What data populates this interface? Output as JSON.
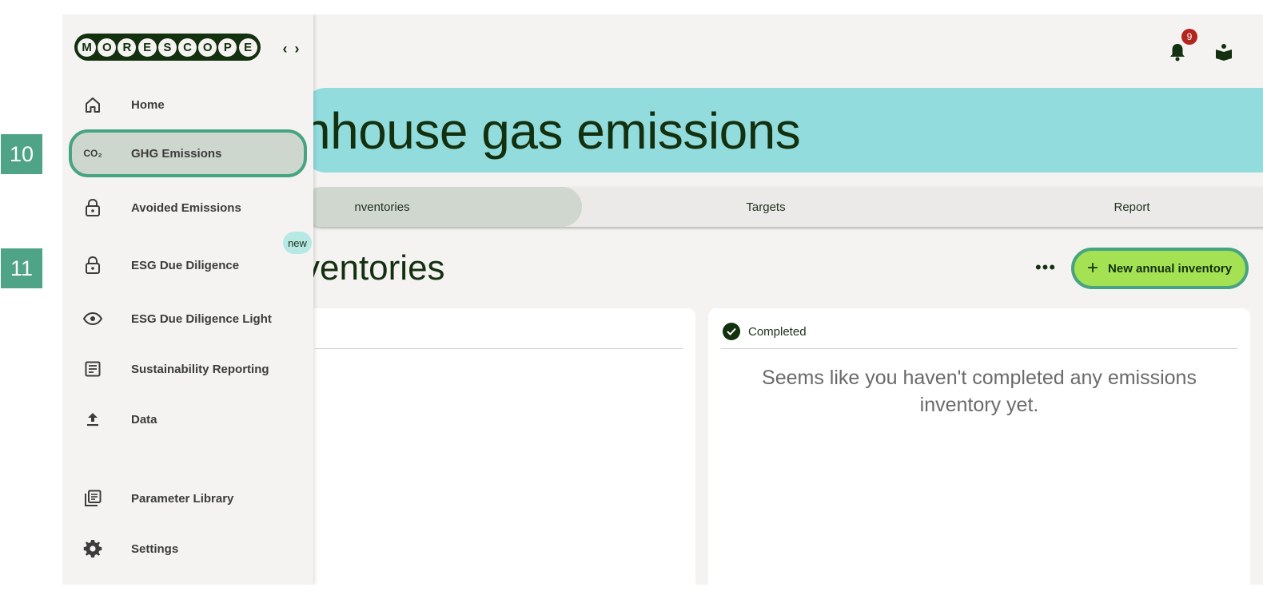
{
  "sidebar": {
    "logo_letters": [
      "M",
      "O",
      "R",
      "E",
      "S",
      "C",
      "O",
      "P",
      "E"
    ],
    "collapse_glyph": "‹ ›",
    "items": [
      {
        "label": "Home",
        "icon": "home-icon"
      },
      {
        "label": "GHG Emissions",
        "icon": "co2-icon",
        "active": true
      },
      {
        "label": "Avoided Emissions",
        "icon": "lock-icon"
      },
      {
        "label": "ESG Due Diligence",
        "icon": "lock-icon"
      },
      {
        "label": "ESG Due Diligence Light",
        "icon": "eye-icon"
      },
      {
        "label": "Sustainability Reporting",
        "icon": "document-icon"
      },
      {
        "label": "Data",
        "icon": "upload-icon"
      },
      {
        "label": "Parameter Library",
        "icon": "library-icon"
      },
      {
        "label": "Settings",
        "icon": "gear-icon"
      }
    ],
    "new_badge": "new",
    "co2_text": "CO₂"
  },
  "topbar": {
    "notification_count": "9"
  },
  "hero": {
    "title": "nhouse gas emissions"
  },
  "tabs": [
    {
      "label": "nventories",
      "active": true
    },
    {
      "label": "Targets"
    },
    {
      "label": "Report"
    }
  ],
  "section": {
    "title": "ventories",
    "more": "•••",
    "new_button": "New annual inventory",
    "plus": "+"
  },
  "cards": {
    "completed_label": "Completed",
    "empty_message": "Seems like you haven't completed any emissions inventory yet."
  },
  "markers": [
    "10",
    "11"
  ],
  "colors": {
    "accent_green": "#47a382",
    "hero_teal": "#92dcdd",
    "button_lime": "#a4e254",
    "dark_green": "#13300f",
    "badge_red": "#b3261e"
  }
}
